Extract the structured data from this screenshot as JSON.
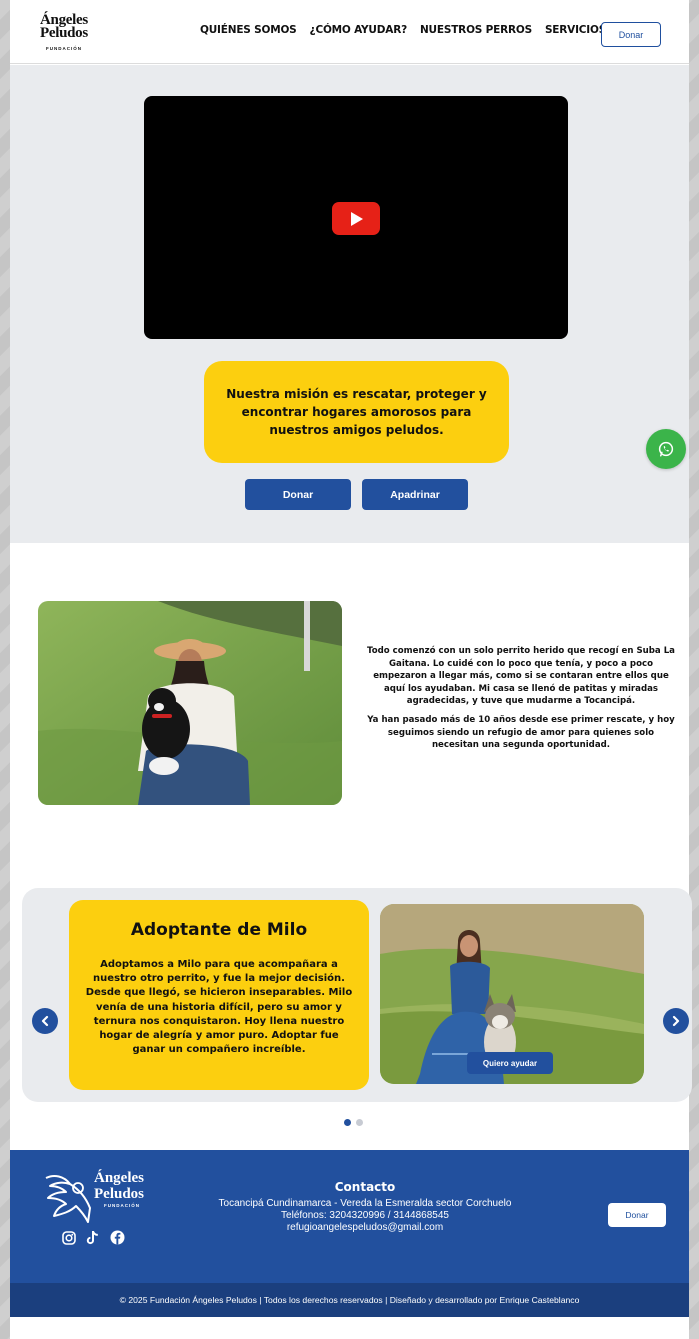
{
  "brand": {
    "name_line1": "Ángeles",
    "name_line2": "Peludos",
    "tagline": "FUNDACIÓN"
  },
  "nav": {
    "items": [
      "QUIÉNES SOMOS",
      "¿CÓMO AYUDAR?",
      "NUESTROS PERROS",
      "SERVICIOS"
    ],
    "donate_label": "Donar"
  },
  "hero": {
    "mission": "Nuestra misión es rescatar, proteger y encontrar hogares amorosos para nuestros amigos peludos.",
    "donate_label": "Donar",
    "sponsor_label": "Apadrinar"
  },
  "story": {
    "paragraph1": "Todo comenzó con un solo perrito herido que recogí en Suba La Gaitana. Lo cuidé con lo poco que tenía, y poco a poco empezaron a llegar más, como si se contaran entre ellos que aquí los ayudaban. Mi casa se llenó de patitas y miradas agradecidas, y tuve que mudarme a Tocancipá.",
    "paragraph2": "Ya han pasado más de 10 años desde ese primer rescate, y hoy seguimos siendo un refugio de amor para quienes solo necesitan una segunda oportunidad."
  },
  "testimonial": {
    "title": "Adoptante de Milo",
    "body": "Adoptamos a Milo para que acompañara a nuestro otro perrito, y fue la mejor decisión. Desde que llegó, se hicieron inseparables. Milo venía de una historia difícil, pero su amor y ternura nos conquistaron. Hoy llena nuestro hogar de alegría y amor puro. Adoptar fue ganar un compañero increíble.",
    "help_label": "Quiero ayudar",
    "active_slide": 1,
    "slide_count": 2
  },
  "footer": {
    "contact_title": "Contacto",
    "address": "Tocancipá Cundinamarca - Vereda la Esmeralda sector Corchuelo",
    "phones": "Teléfonos: 3204320996 / 3144868545",
    "email": "refugioangelespeludos@gmail.com",
    "donate_label": "Donar",
    "social_icons": [
      "instagram-icon",
      "tiktok-icon",
      "facebook-icon"
    ],
    "copyright": "© 2025 Fundación Ángeles Peludos | Todos los derechos reservados | Diseñado y desarrollado por Enrique Casteblanco"
  },
  "colors": {
    "brand_blue": "#22509e",
    "accent_yellow": "#fccf0f",
    "whatsapp_green": "#3bb44a",
    "youtube_red": "#e62117"
  }
}
